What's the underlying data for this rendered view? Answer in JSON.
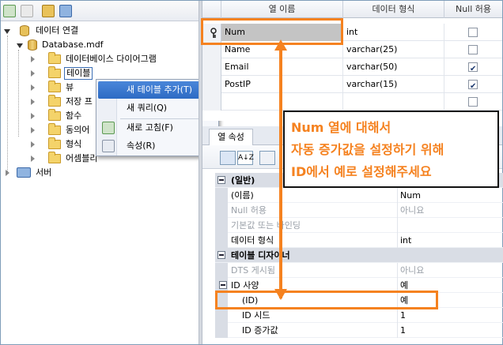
{
  "explorer": {
    "tree": {
      "data_connections": "데이터 연결",
      "database": "Database.mdf",
      "diagrams": "데이터베이스 다이어그램",
      "tables": "테이블",
      "views": "뷰",
      "stored_procs": "저장 프",
      "functions": "함수",
      "synonyms": "동의어",
      "types": "형식",
      "assemblies": "어셈블리",
      "servers": "서버"
    },
    "context_menu": {
      "add_table": "새 테이블 추가(T)",
      "new_query": "새 쿼리(Q)",
      "refresh": "새로 고침(F)",
      "properties": "속성(R)"
    }
  },
  "grid": {
    "headers": {
      "column_name": "열 이름",
      "data_type": "데이터 형식",
      "allow_nulls": "Null 허용"
    },
    "rows": [
      {
        "name": "Num",
        "type": "int",
        "null": false
      },
      {
        "name": "Name",
        "type": "varchar(25)",
        "null": false
      },
      {
        "name": "Email",
        "type": "varchar(50)",
        "null": true
      },
      {
        "name": "PostIP",
        "type": "varchar(15)",
        "null": true
      },
      {
        "name": "",
        "type": "",
        "null": false
      }
    ]
  },
  "properties": {
    "tab_label": "열 속성",
    "toolbar": {
      "categorized": "",
      "alphabetical": "A↓Z"
    },
    "rows": [
      {
        "name": "(일반)",
        "value": "",
        "category": true
      },
      {
        "name": "(이름)",
        "value": "Num"
      },
      {
        "name": "Null 허용",
        "value": "아니요"
      },
      {
        "name": "기본값 또는 바인딩",
        "value": ""
      },
      {
        "name": "데이터 형식",
        "value": "int"
      },
      {
        "name": "테이블 디자이너",
        "value": "",
        "category": true
      },
      {
        "name": "DTS 게시됨",
        "value": "아니요"
      },
      {
        "name": "ID 사양",
        "value": "예"
      },
      {
        "name": "(ID)",
        "value": "예"
      },
      {
        "name": "ID 시드",
        "value": "1"
      },
      {
        "name": "ID 증가값",
        "value": "1"
      }
    ]
  },
  "callout": {
    "line1": "Num 열에 대해서",
    "line2": "자동 증가값을 설정하기 위해",
    "line3": "ID에서 예로 설정해주세요"
  },
  "colors": {
    "annotation": "#f58220",
    "selection": "#3c6fb5"
  }
}
